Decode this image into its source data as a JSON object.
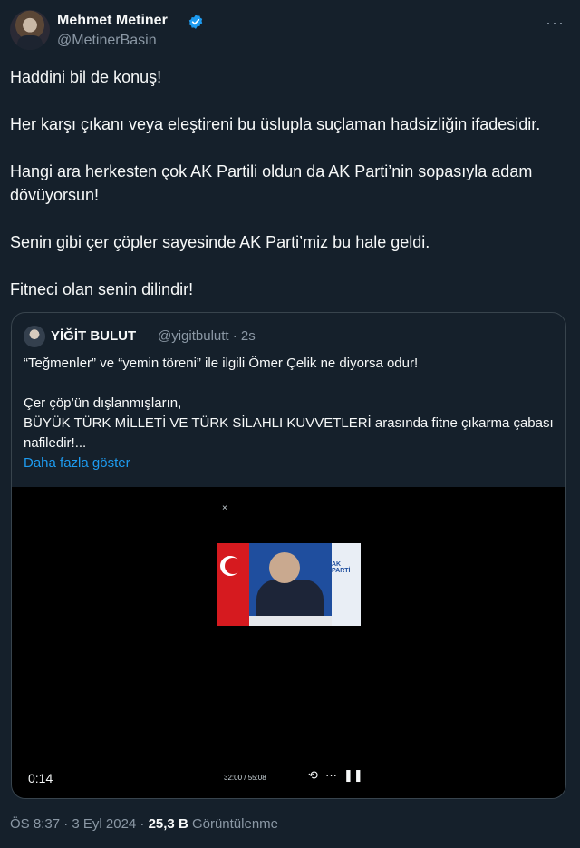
{
  "author": {
    "name": "Mehmet Metiner",
    "handle": "@MetinerBasin"
  },
  "tweet": {
    "paragraphs": [
      "Haddini bil de konuş!",
      "Her karşı çıkanı veya eleştireni bu üslupla suçlaman hadsizliğin ifadesidir.",
      "Hangi ara herkesten çok AK Partili oldun da AK Parti’nin sopasıyla adam dövüyorsun!",
      "Senin gibi çer çöpler sayesinde AK Parti’miz bu hale geldi.",
      "Fitneci olan senin dilindir!"
    ]
  },
  "quote": {
    "name": "YİĞİT BULUT",
    "handle_time": "@yigitbulutt · 2s",
    "line1": "“Teğmenler” ve “yemin töreni” ile ilgili Ömer Çelik ne diyorsa odur!",
    "line2": "Çer çöp’ün dışlanmışların,",
    "line3": "BÜYÜK TÜRK MİLLETİ VE TÜRK SİLAHLI KUVVETLERİ arasında fitne çıkarma çabası nafiledir!...",
    "show_more": "Daha fazla göster",
    "video": {
      "close": "×",
      "thumb_banner": "AK PARTİ",
      "elapsed": "0:14",
      "range": "32:00 / 55:08",
      "repeat_icon": "⟲",
      "more_icon": "···",
      "pause_icon": "❚❚"
    }
  },
  "meta": {
    "time": "ÖS 8:37 · 3 Eyl 2024 · ",
    "views_count": "25,3 B",
    "views_label": " Görüntülenme"
  },
  "more_icon": "···",
  "colors": {
    "background": "#15202b",
    "text": "#f7f9f9",
    "muted": "#8b98a5",
    "link": "#1d9bf0",
    "verified": "#1d9bf0",
    "border": "#38444d"
  }
}
